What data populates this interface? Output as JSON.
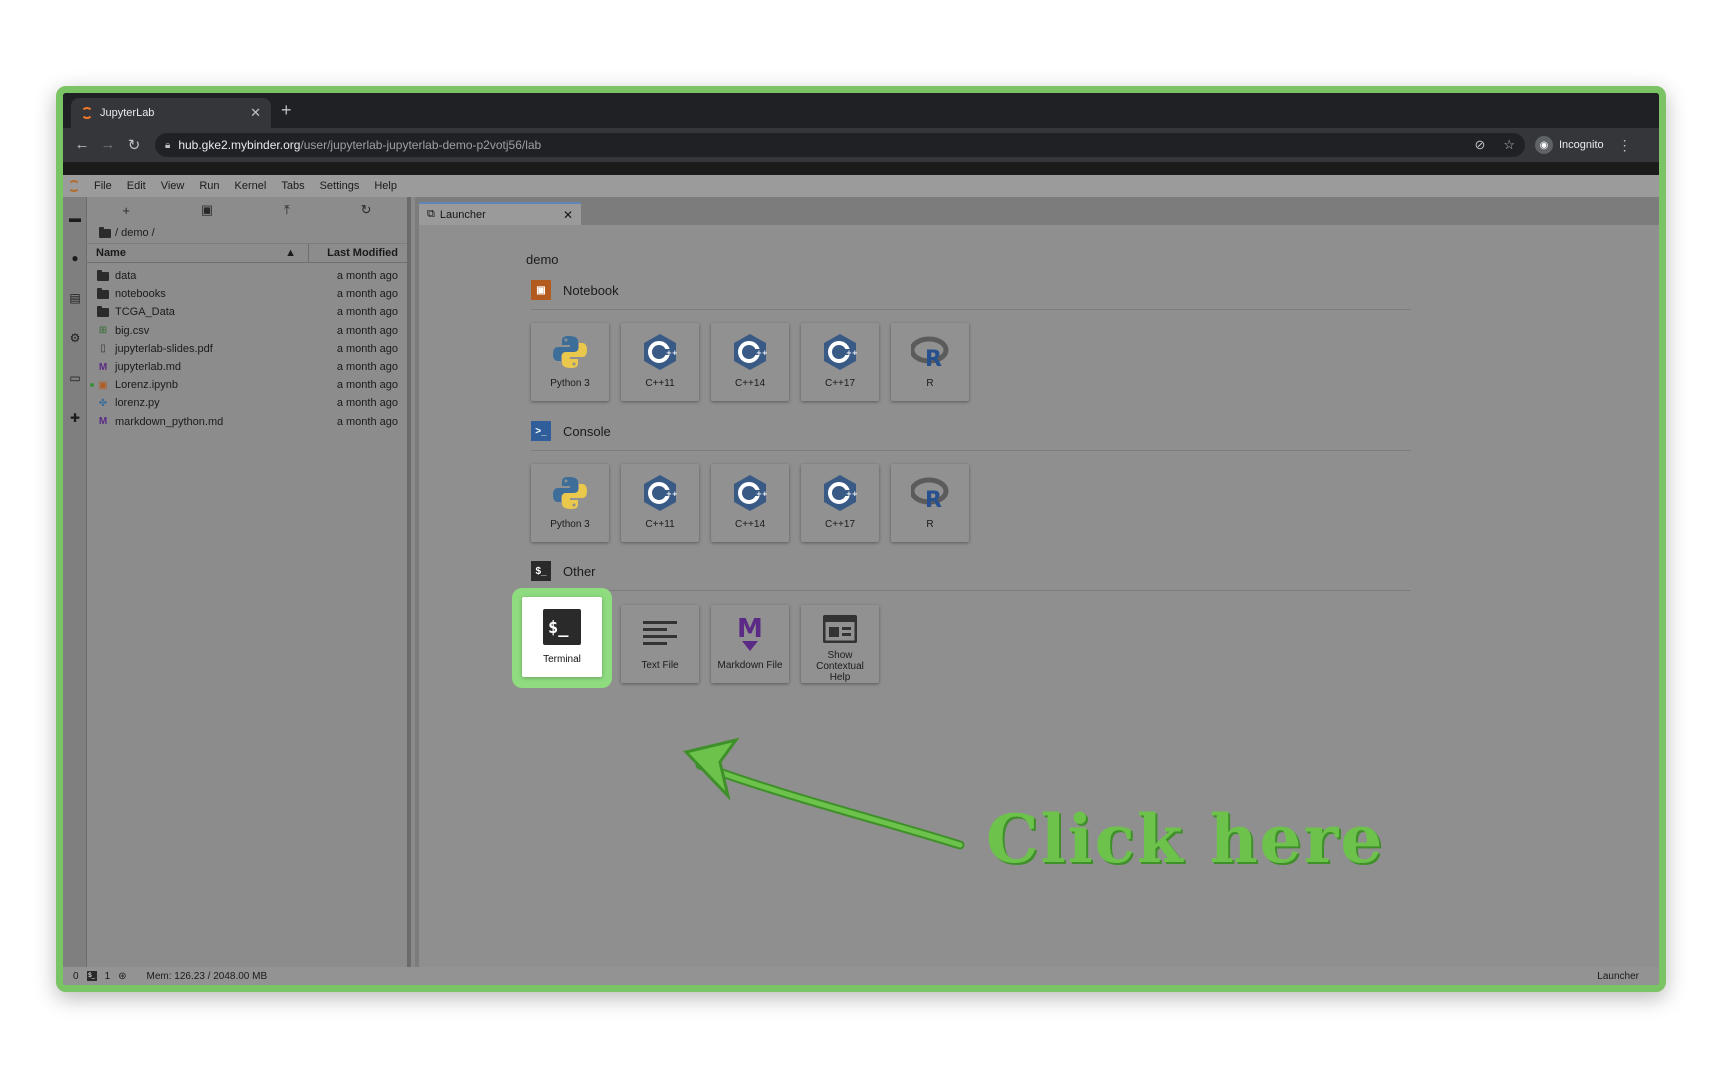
{
  "browser": {
    "tab_title": "JupyterLab",
    "url_host": "hub.gke2.mybinder.org",
    "url_path": "/user/jupyterlab-jupyterlab-demo-p2votj56/lab",
    "profile_label": "Incognito"
  },
  "menubar": {
    "items": [
      "File",
      "Edit",
      "View",
      "Run",
      "Kernel",
      "Tabs",
      "Settings",
      "Help"
    ]
  },
  "filebrowser": {
    "breadcrumb": "/ demo /",
    "col_name": "Name",
    "col_modified": "Last Modified",
    "files": [
      {
        "name": "data",
        "modified": "a month ago",
        "icon": "folder-icon"
      },
      {
        "name": "notebooks",
        "modified": "a month ago",
        "icon": "folder-icon"
      },
      {
        "name": "TCGA_Data",
        "modified": "a month ago",
        "icon": "folder-icon"
      },
      {
        "name": "big.csv",
        "modified": "a month ago",
        "icon": "spreadsheet-icon"
      },
      {
        "name": "jupyterlab-slides.pdf",
        "modified": "a month ago",
        "icon": "file-icon"
      },
      {
        "name": "jupyterlab.md",
        "modified": "a month ago",
        "icon": "markdown-icon"
      },
      {
        "name": "Lorenz.ipynb",
        "modified": "a month ago",
        "icon": "notebook-icon"
      },
      {
        "name": "lorenz.py",
        "modified": "a month ago",
        "icon": "python-icon"
      },
      {
        "name": "markdown_python.md",
        "modified": "a month ago",
        "icon": "markdown-icon"
      }
    ]
  },
  "launcher": {
    "tab_label": "Launcher",
    "cwd": "demo",
    "sections": {
      "notebook": {
        "title": "Notebook",
        "items": [
          "Python 3",
          "C++11",
          "C++14",
          "C++17",
          "R"
        ]
      },
      "console": {
        "title": "Console",
        "items": [
          "Python 3",
          "C++11",
          "C++14",
          "C++17",
          "R"
        ]
      },
      "other": {
        "title": "Other",
        "items": [
          "Terminal",
          "Text File",
          "Markdown File",
          "Show Contextual Help"
        ]
      }
    }
  },
  "statusbar": {
    "count_a": "0",
    "count_b": "1",
    "memory": "Mem: 126.23 / 2048.00 MB",
    "right": "Launcher"
  },
  "annotation": {
    "callout": "Click here"
  },
  "colors": {
    "highlight": "#8fdb7f",
    "annotation_green": "#6cc24a",
    "python_blue": "#3c6e99",
    "python_yellow": "#e9c84b",
    "cpp_blue": "#3a5a86",
    "markdown_purple": "#5b2a86"
  }
}
